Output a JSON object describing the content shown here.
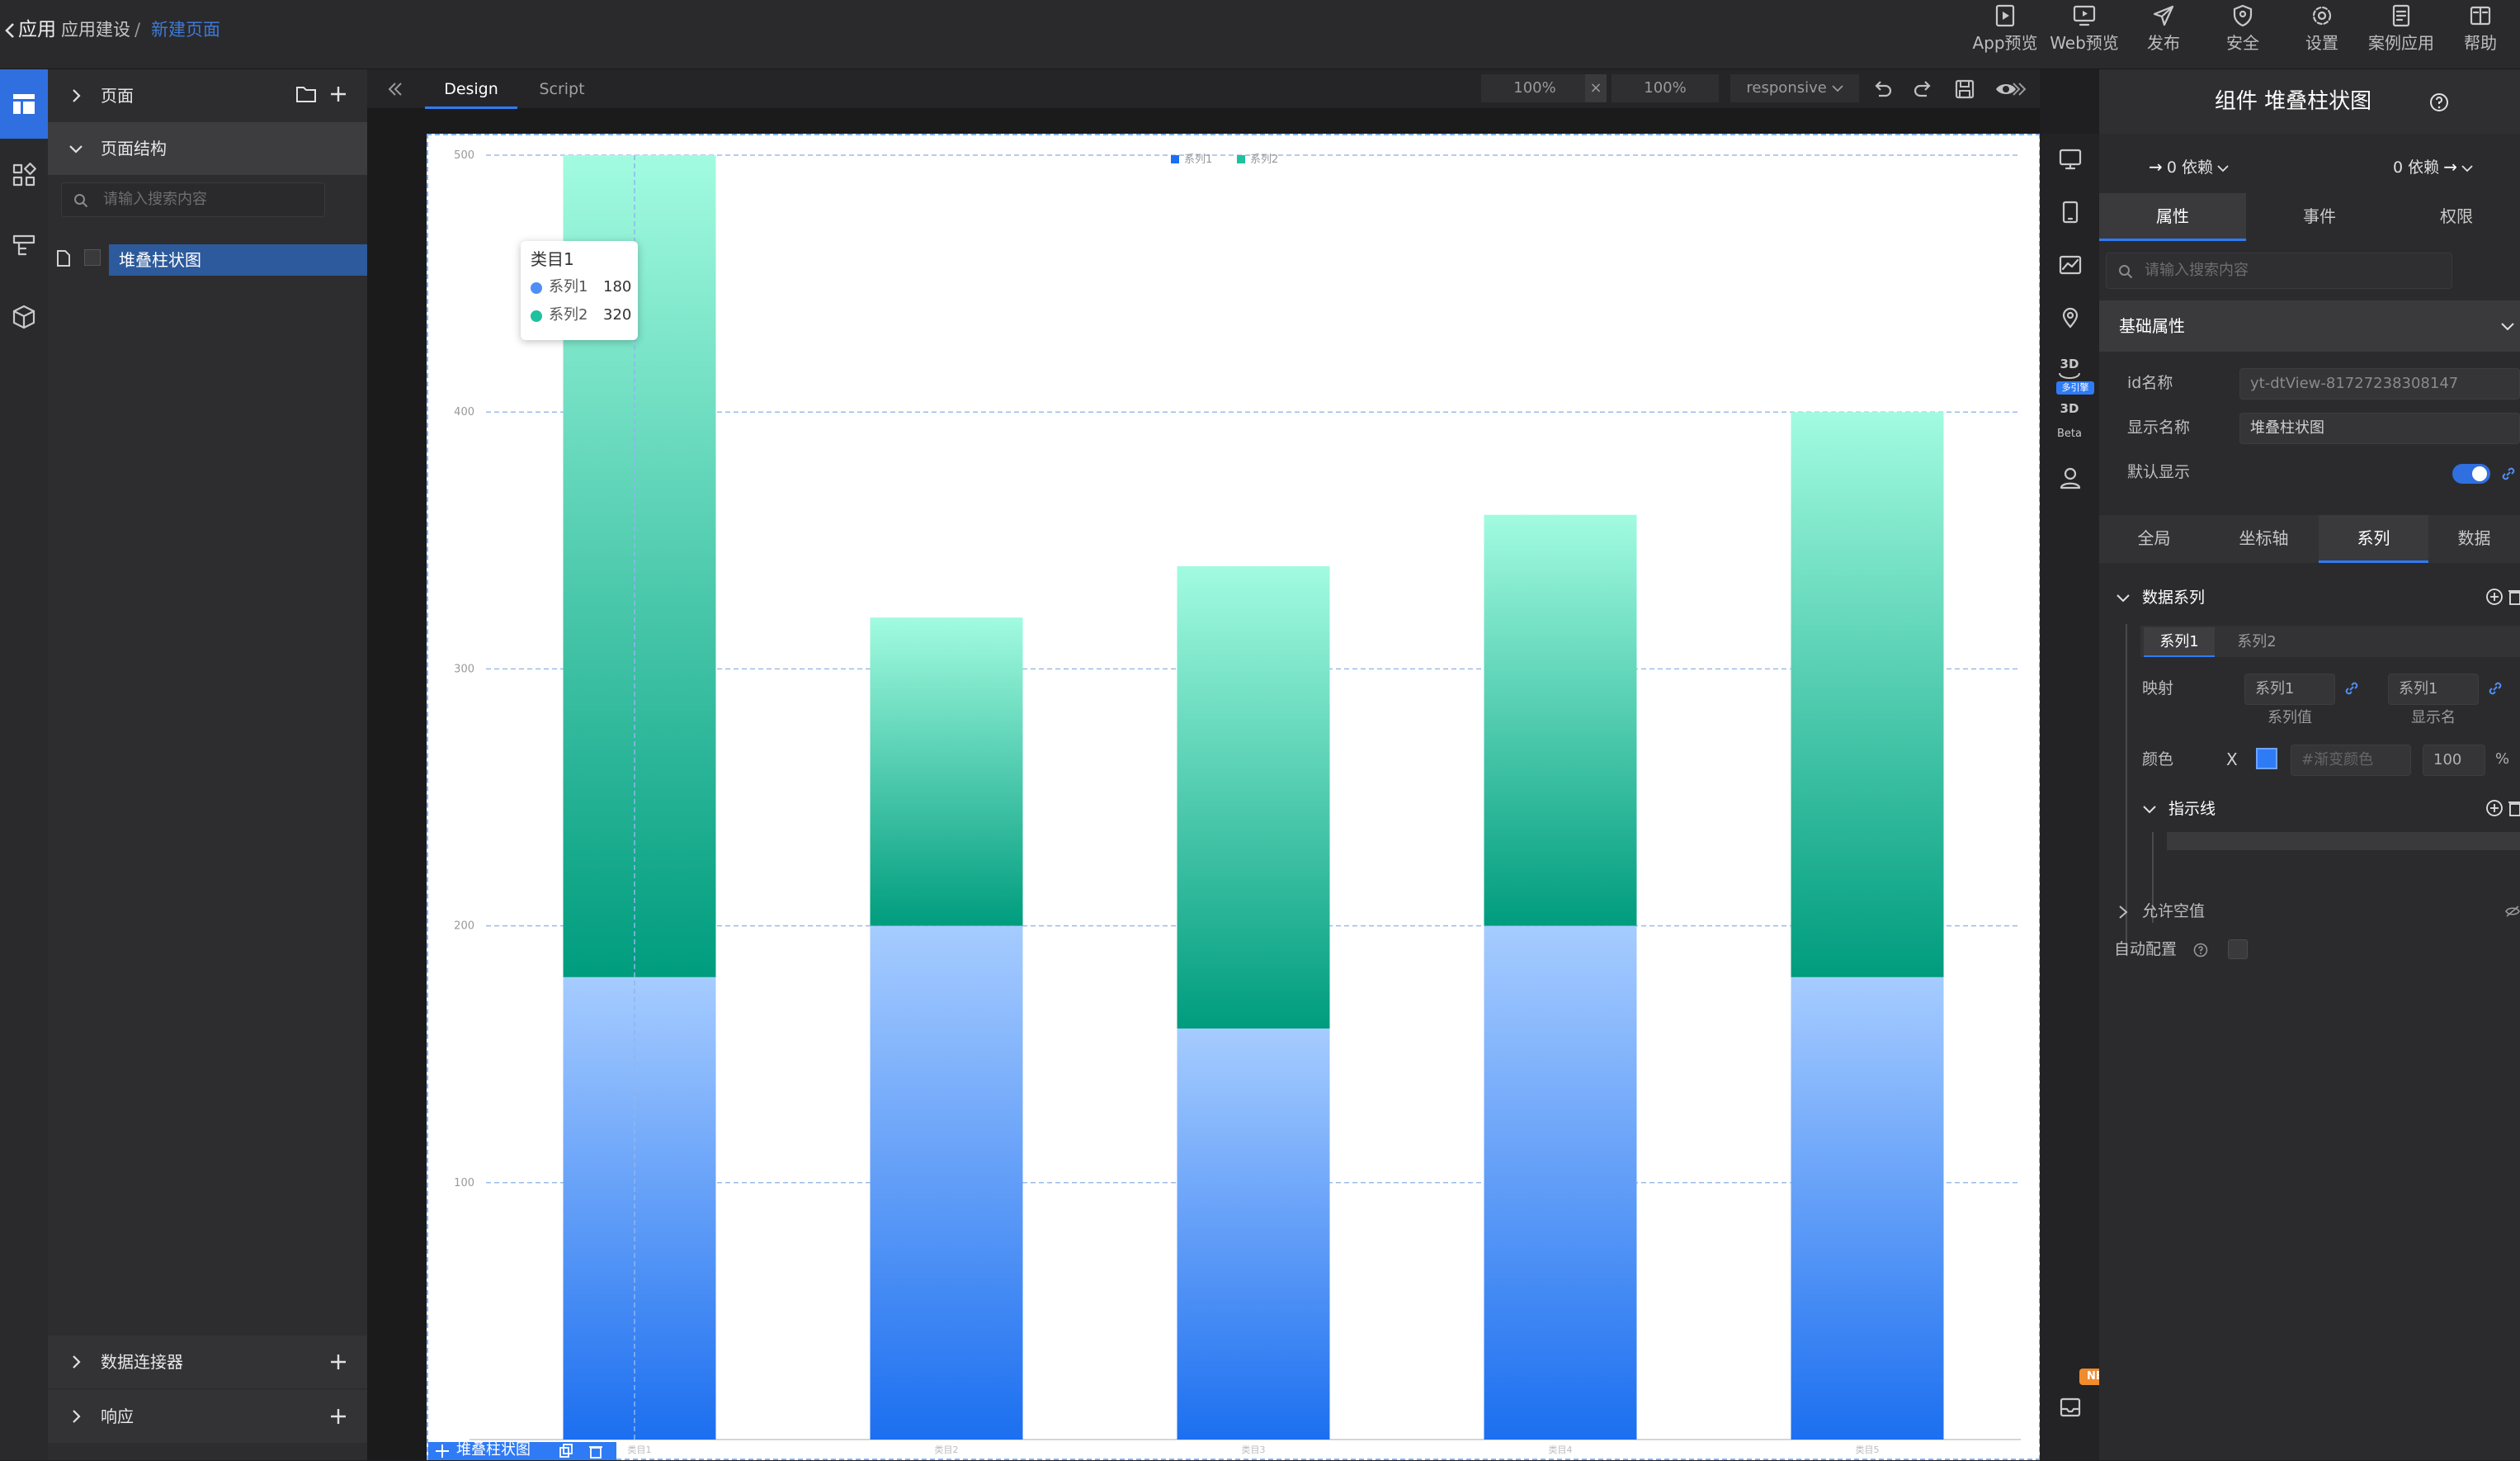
{
  "breadcrumb": {
    "back_label": "应用",
    "parent": "应用建设",
    "separator": "/",
    "current": "新建页面"
  },
  "top_tools": [
    {
      "label": "App预览",
      "icon": "play-square-icon"
    },
    {
      "label": "Web预览",
      "icon": "monitor-play-icon"
    },
    {
      "label": "发布",
      "icon": "send-icon"
    },
    {
      "label": "安全",
      "icon": "shield-icon"
    },
    {
      "label": "设置",
      "icon": "gear-icon"
    },
    {
      "label": "案例应用",
      "icon": "document-icon"
    },
    {
      "label": "帮助",
      "icon": "book-icon"
    }
  ],
  "left_panel": {
    "pages_label": "页面",
    "structure_label": "页面结构",
    "search_placeholder": "请输入搜索内容",
    "tree_item": "堆叠柱状图",
    "connectors_label": "数据连接器",
    "response_label": "响应"
  },
  "canvas_toolbar": {
    "tab_design": "Design",
    "tab_script": "Script",
    "zoom_a": "100%",
    "zoom_sep": "×",
    "zoom_b": "100%",
    "layout_mode": "responsive"
  },
  "selection_tag": "堆叠柱状图",
  "chart_data": {
    "type": "bar",
    "stacked": true,
    "categories": [
      "类目1",
      "类目2",
      "类目3",
      "类目4",
      "类目5"
    ],
    "series": [
      {
        "name": "系列1",
        "values": [
          180,
          200,
          160,
          200,
          180
        ],
        "color_top": "#a6ccff",
        "color_bottom": "#1c6ff0"
      },
      {
        "name": "系列2",
        "values": [
          320,
          120,
          180,
          160,
          220
        ],
        "color_top": "#a2fbe0",
        "color_bottom": "#009c7e"
      }
    ],
    "ylim": [
      0,
      500
    ],
    "yticks": [
      "100",
      "200",
      "300",
      "400",
      "500"
    ],
    "grid": true,
    "legend_position": "top-center",
    "tooltip": {
      "title": "类目1",
      "rows": [
        {
          "name": "系列1",
          "value": "180"
        },
        {
          "name": "系列2",
          "value": "320"
        }
      ]
    }
  },
  "right_strip": {
    "icons": [
      "monitor-icon",
      "tablet-icon",
      "line-chart-icon",
      "map-pin-icon",
      "cube-3d-icon",
      "cube-3d-beta-icon",
      "user-icon",
      "inbox-icon"
    ],
    "label_3d": "3D",
    "badge_multi": "多引擎",
    "label_beta": "Beta",
    "badge_new": "NEW"
  },
  "right_panel": {
    "title": "组件 堆叠柱状图",
    "dep_in": "0 依赖",
    "dep_out": "0 依赖",
    "tabs": [
      "属性",
      "事件",
      "权限"
    ],
    "search_placeholder": "请输入搜索内容",
    "section_basic": "基础属性",
    "id_label": "id名称",
    "id_value": "yt-dtView-81727238308147",
    "display_label": "显示名称",
    "display_value": "堆叠柱状图",
    "default_show_label": "默认显示",
    "default_show": true,
    "sub_tabs": [
      "全局",
      "坐标轴",
      "系列",
      "数据"
    ],
    "data_series_label": "数据系列",
    "series_tabs": [
      "系列1",
      "系列2"
    ],
    "mapping_label": "映射",
    "map_value": "系列1",
    "map_value_caption": "系列值",
    "map_name": "系列1",
    "map_name_caption": "显示名",
    "color_label": "颜色",
    "color_clear": "X",
    "color_swatch": "#2f7bf6",
    "gradient_placeholder": "#渐变颜色",
    "opacity_value": "100",
    "opacity_unit": "%",
    "indicator_label": "指示线",
    "allow_null_label": "允许空值",
    "auto_config_label": "自动配置"
  }
}
